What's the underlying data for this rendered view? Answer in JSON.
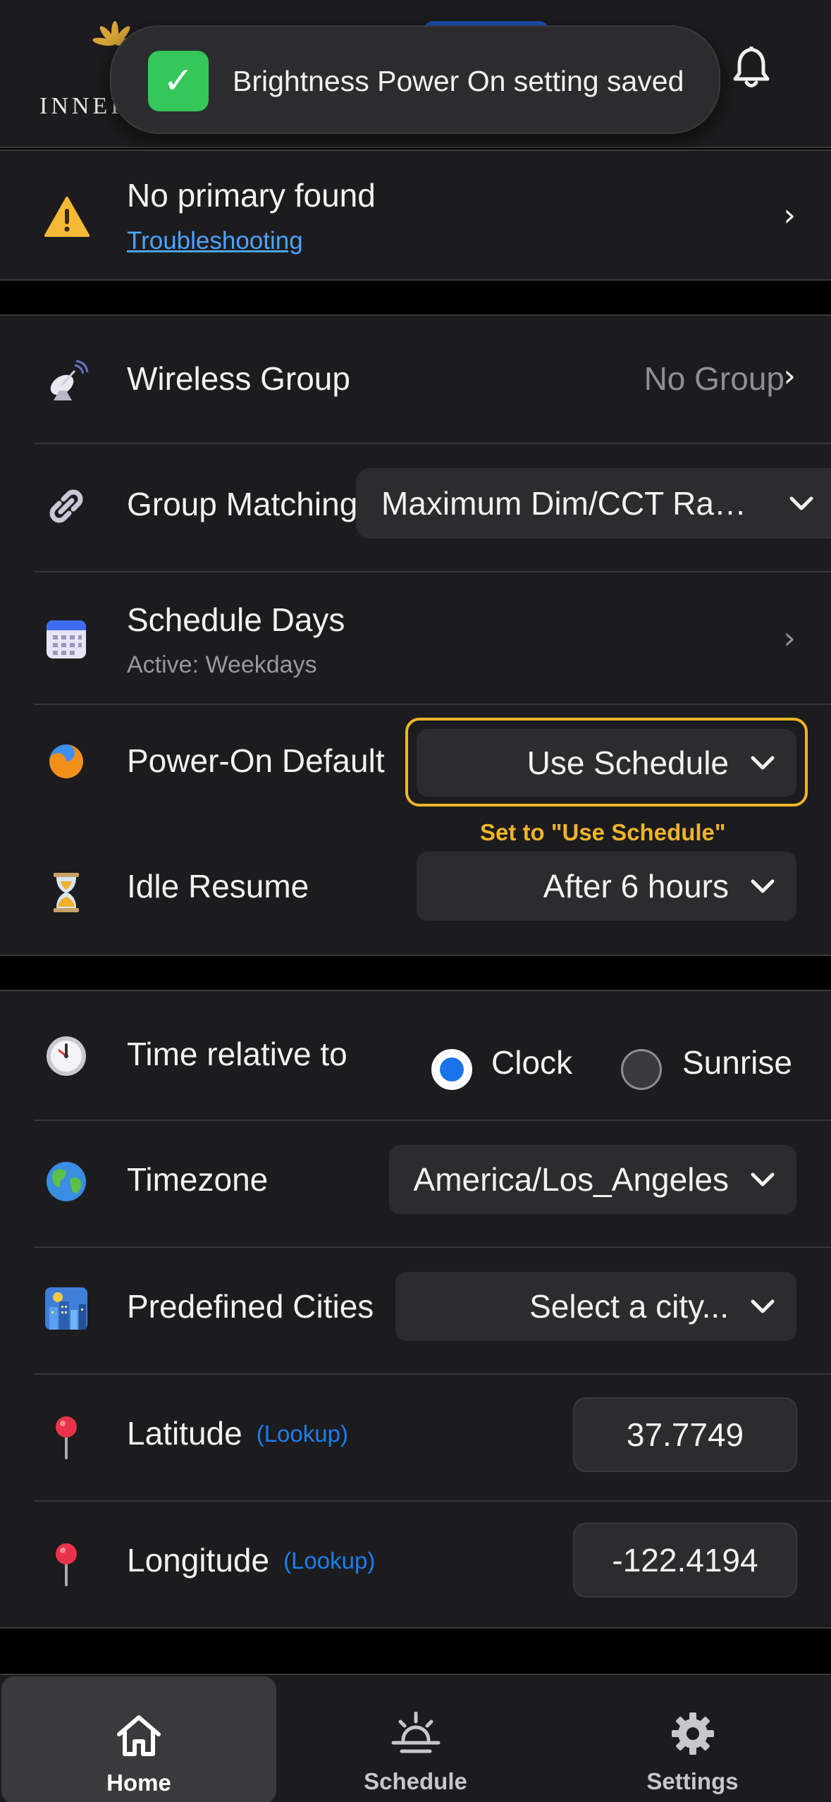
{
  "header": {
    "logo_text": "INNER",
    "toast": {
      "message": "Brightness Power On setting saved",
      "check": "✓"
    }
  },
  "alert": {
    "title": "No primary found",
    "link": "Troubleshooting",
    "chevron": "›"
  },
  "group_settings": {
    "wireless_group": {
      "label": "Wireless Group",
      "value": "No Group",
      "chevron": "›"
    },
    "group_matching": {
      "label": "Group Matching",
      "value": "Maximum Dim/CCT Ra…"
    },
    "schedule_days": {
      "label": "Schedule Days",
      "sublabel": "Active: Weekdays",
      "chevron": "›"
    },
    "power_on_default": {
      "label": "Power-On Default",
      "value": "Use Schedule",
      "hint": "Set to \"Use Schedule\""
    },
    "idle_resume": {
      "label": "Idle Resume",
      "value": "After 6 hours"
    }
  },
  "location_settings": {
    "time_relative": {
      "label": "Time relative to",
      "options": [
        "Clock",
        "Sunrise"
      ],
      "selected": "Clock"
    },
    "timezone": {
      "label": "Timezone",
      "value": "America/Los_Angeles"
    },
    "cities": {
      "label": "Predefined Cities",
      "placeholder": "Select a city..."
    },
    "latitude": {
      "label": "Latitude",
      "lookup": "(Lookup)",
      "value": "37.7749"
    },
    "longitude": {
      "label": "Longitude",
      "lookup": "(Lookup)",
      "value": "-122.4194"
    }
  },
  "tabs": [
    {
      "label": "Home",
      "icon": "home-icon",
      "active": true
    },
    {
      "label": "Schedule",
      "icon": "sunrise-icon",
      "active": false
    },
    {
      "label": "Settings",
      "icon": "gear-icon",
      "active": false
    }
  ],
  "colors": {
    "accent": "#1a73e8",
    "highlight": "#f0b429",
    "success": "#34c759",
    "link": "#4da3ff"
  }
}
